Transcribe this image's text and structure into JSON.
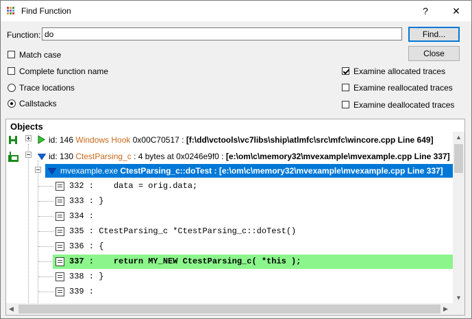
{
  "window": {
    "title": "Find Function",
    "help_button": "?",
    "close_button": "✕"
  },
  "form": {
    "function_label": "Function:",
    "function_value": "do",
    "find_button": "Find...",
    "close_button": "Close",
    "match_case": {
      "label": "Match case",
      "checked": false
    },
    "complete_function_name": {
      "label": "Complete function name",
      "checked": false
    },
    "trace_locations": {
      "label": "Trace locations",
      "selected": false
    },
    "callstacks": {
      "label": "Callstacks",
      "selected": true
    },
    "examine_allocated": {
      "label": "Examine allocated traces",
      "checked": true
    },
    "examine_reallocated": {
      "label": "Examine reallocated traces",
      "checked": false
    },
    "examine_deallocated": {
      "label": "Examine deallocated traces",
      "checked": false
    }
  },
  "objects": {
    "title": "Objects",
    "row1": {
      "prefix": "id: 146 ",
      "kind": "Windows Hook",
      "addr": " 0x00C70517 : ",
      "location": "[f:\\dd\\vctools\\vc7libs\\ship\\atlmfc\\src\\mfc\\wincore.cpp Line 649]"
    },
    "row2": {
      "prefix": "id: 130 ",
      "kind": "CtestParsing_c",
      "addr": " : 4 bytes at 0x0246e9f0 : ",
      "location": "[e:\\om\\c\\memory32\\mvexample\\mvexample.cpp Line 337]"
    },
    "row3": {
      "module": "mvexample.exe ",
      "func": "CtestParsing_c::doTest : [e:\\om\\c\\memory32\\mvexample\\mvexample.cpp Line 337]"
    },
    "source_lines": [
      {
        "num": "332",
        "text": " :    data = orig.data;",
        "highlight": false
      },
      {
        "num": "333",
        "text": " : }",
        "highlight": false
      },
      {
        "num": "334",
        "text": " :",
        "highlight": false
      },
      {
        "num": "335",
        "text": " : CtestParsing_c *CtestParsing_c::doTest()",
        "highlight": false
      },
      {
        "num": "336",
        "text": " : {",
        "highlight": false
      },
      {
        "num": "337",
        "text": " :    return MY_NEW CtestParsing_c( *this );",
        "highlight": true
      },
      {
        "num": "338",
        "text": " : }",
        "highlight": false
      },
      {
        "num": "339",
        "text": " :",
        "highlight": false
      }
    ]
  }
}
